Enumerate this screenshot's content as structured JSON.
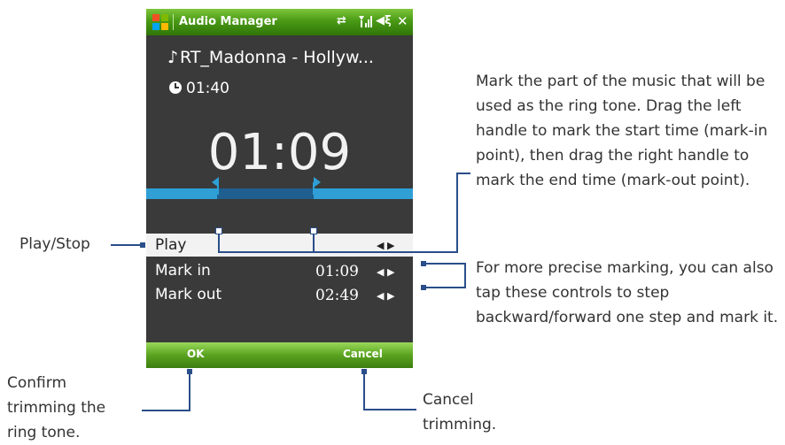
{
  "app": {
    "title": "Audio Manager"
  },
  "status_icons": [
    "start-icon",
    "sync-icon",
    "signal-icon",
    "volume-icon",
    "close-icon"
  ],
  "song": {
    "title": "RT_Madonna - Hollyw...",
    "duration": "01:40"
  },
  "current_time": "01:09",
  "trim": {
    "mark_in_fraction": 0.27,
    "mark_out_fraction": 0.63
  },
  "menu": {
    "play": "Play",
    "mark_in_label": "Mark in",
    "mark_in_value": "01:09",
    "mark_out_label": "Mark out",
    "mark_out_value": "02:49"
  },
  "softkeys": {
    "left": "OK",
    "right": "Cancel"
  },
  "callouts": {
    "mark": "Mark the part of the music that will be used as the ring tone. Drag the left handle to mark the start time (mark-in point), then drag the right handle to mark the end time (mark-out point).",
    "play": "Play/Stop",
    "step": "For more precise marking, you can also tap these controls to step backward/forward one step and mark it.",
    "confirm": "Confirm trimming the ring tone.",
    "cancel": "Cancel trimming."
  },
  "colors": {
    "titlebar": "#4a9a16",
    "track": "#2f9fd6",
    "track_selected": "#1f5f8f",
    "callout_line": "#2a4e8a"
  }
}
